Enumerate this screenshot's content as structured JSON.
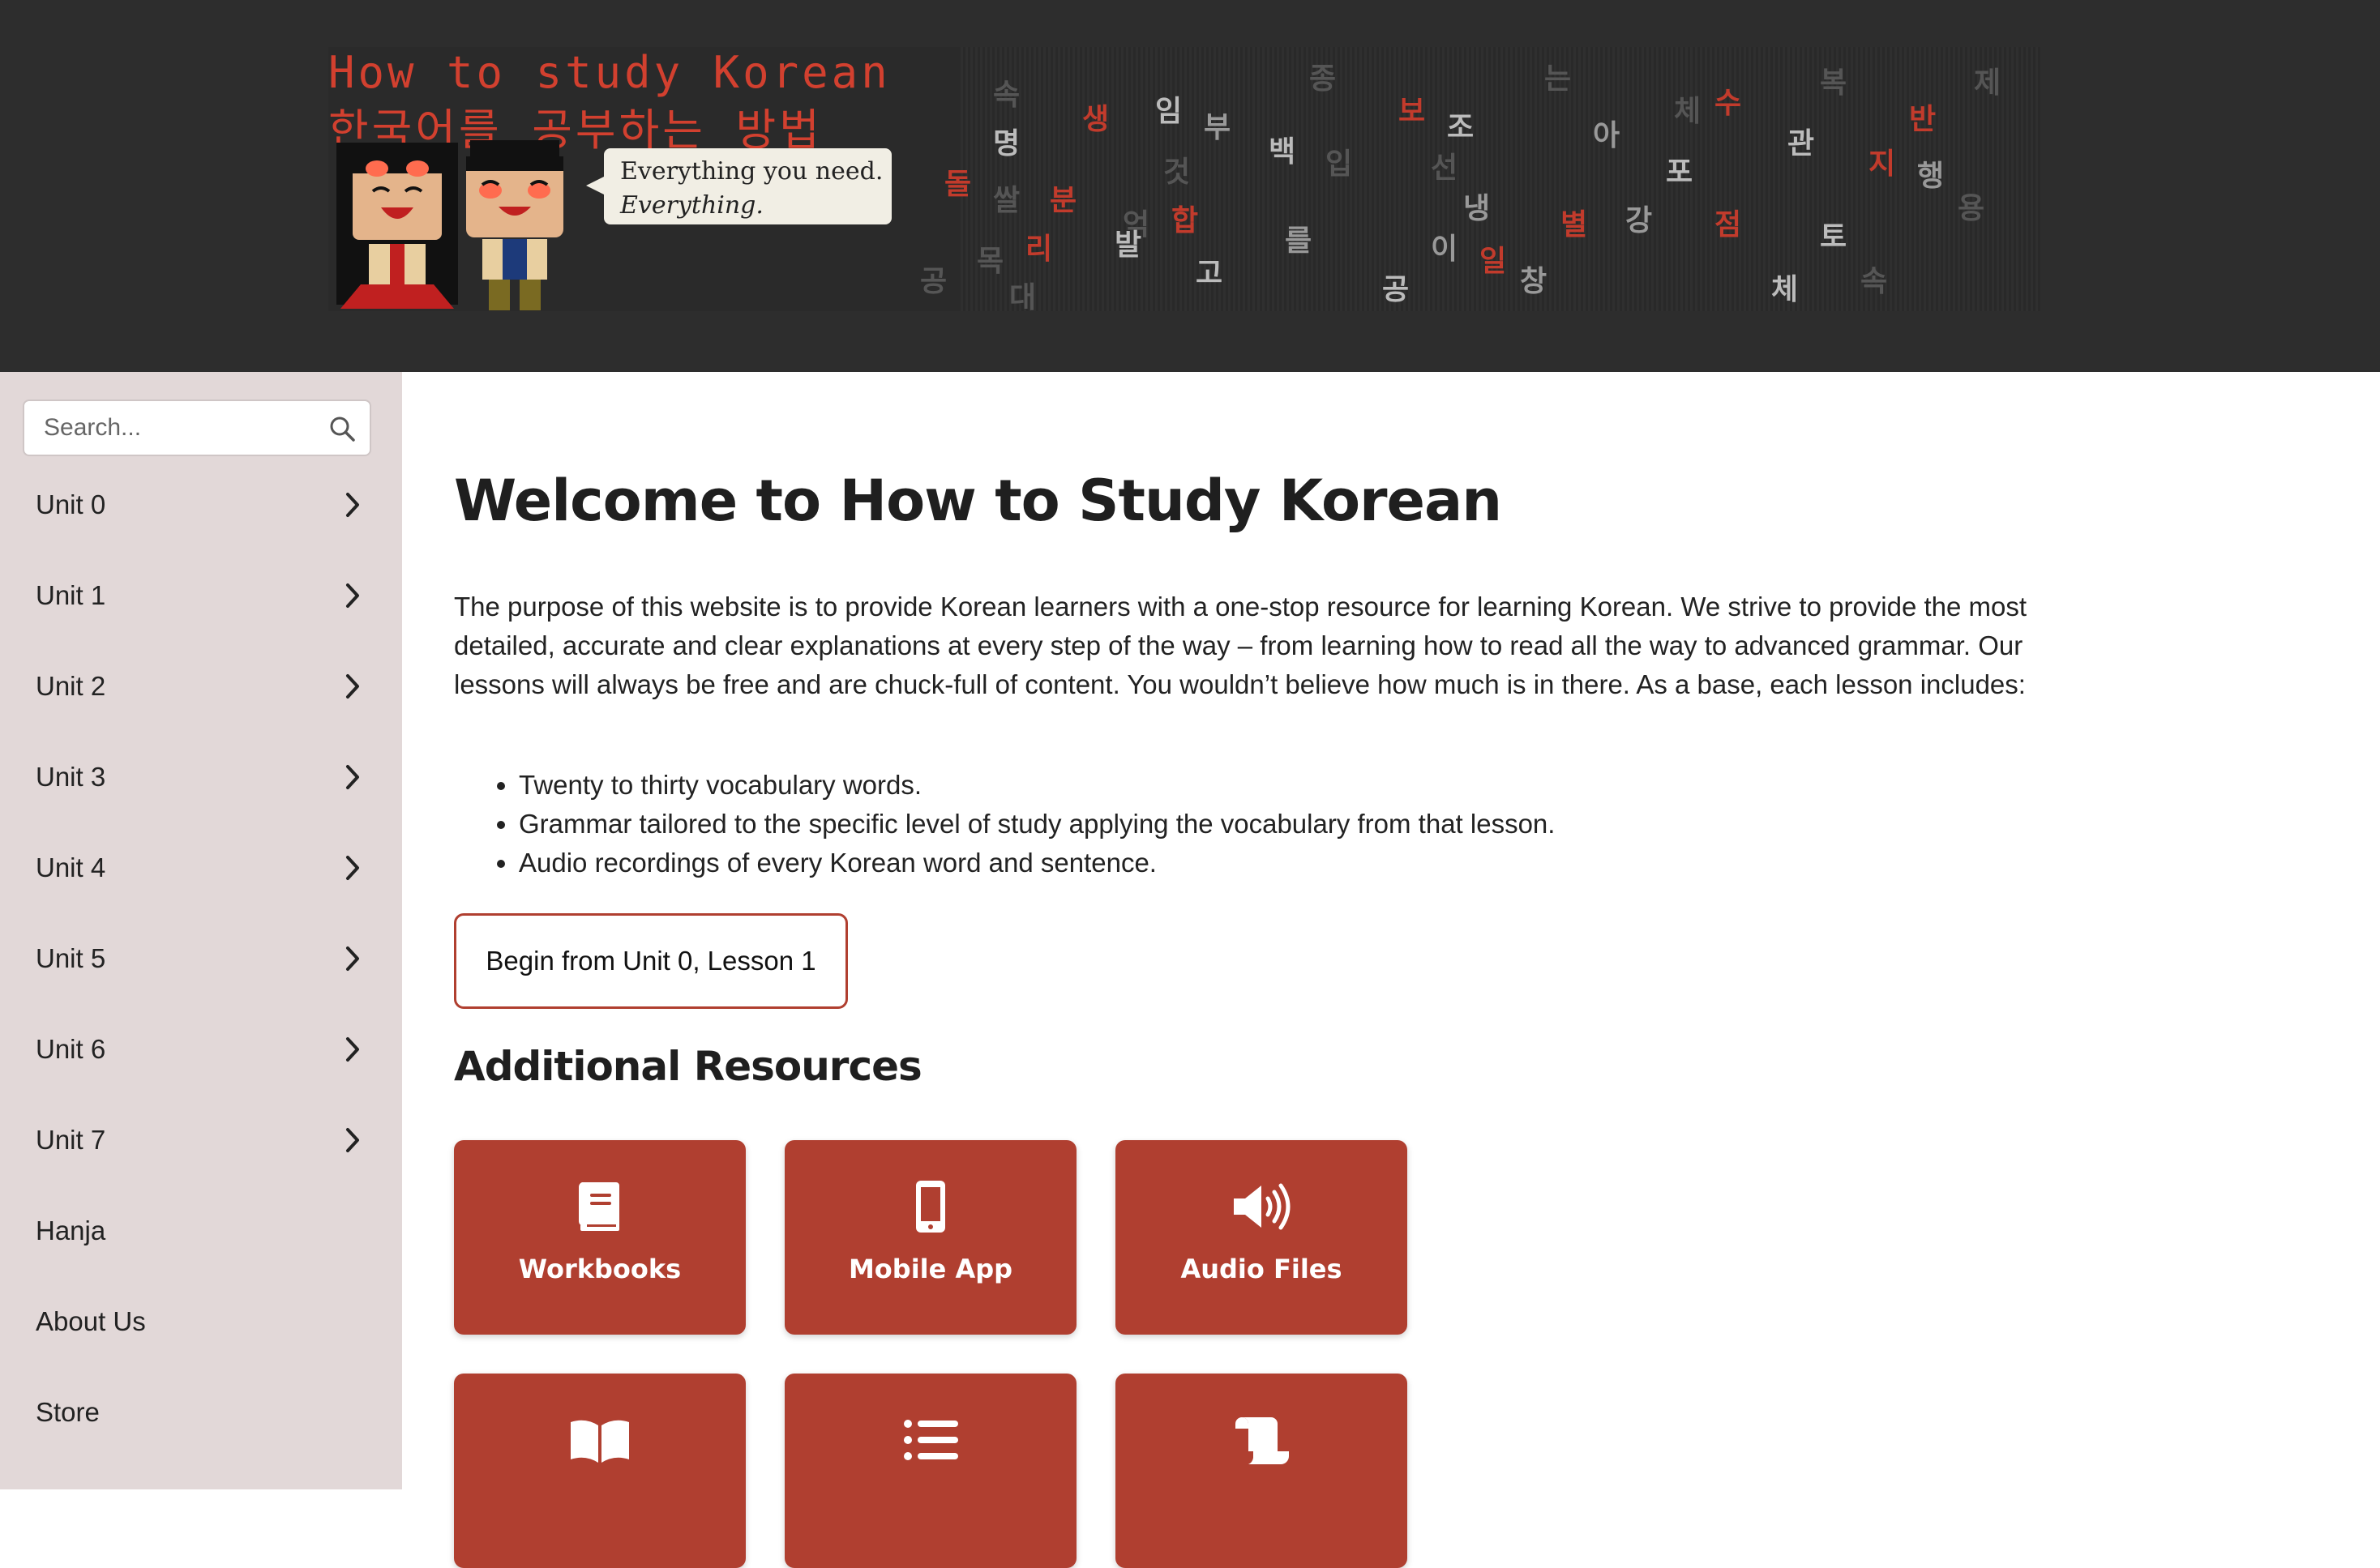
{
  "banner": {
    "title_en": "How to study Korean",
    "title_ko": "한국어를 공부하는 방법",
    "speech_line1": "Everything you need.",
    "speech_line2": "Everything."
  },
  "sidebar": {
    "search_placeholder": "Search...",
    "items": [
      {
        "label": "Unit 0",
        "has_arrow": true
      },
      {
        "label": "Unit 1",
        "has_arrow": true
      },
      {
        "label": "Unit 2",
        "has_arrow": true
      },
      {
        "label": "Unit 3",
        "has_arrow": true
      },
      {
        "label": "Unit 4",
        "has_arrow": true
      },
      {
        "label": "Unit 5",
        "has_arrow": true
      },
      {
        "label": "Unit 6",
        "has_arrow": true
      },
      {
        "label": "Unit 7",
        "has_arrow": true
      },
      {
        "label": "Hanja",
        "has_arrow": false
      },
      {
        "label": "About Us",
        "has_arrow": false
      },
      {
        "label": "Store",
        "has_arrow": false
      }
    ]
  },
  "main": {
    "title": "Welcome to How to Study Korean",
    "intro": "The purpose of this website is to provide Korean learners with a one-stop resource for learning Korean. We strive to provide the most detailed, accurate and clear explanations at every step of the way – from learning how to read all the way to advanced grammar. Our lessons will always be free and are chuck-full of content. You wouldn’t believe how much is in there. As a base, each lesson includes:",
    "bullets": [
      "Twenty to thirty vocabulary words.",
      "Grammar tailored to the specific level of study applying the vocabulary from that lesson.",
      "Audio recordings of every Korean word and sentence."
    ],
    "begin_button": "Begin from Unit 0, Lesson 1",
    "resources_heading": "Additional Resources",
    "resources": [
      {
        "label": "Workbooks",
        "icon": "book-icon"
      },
      {
        "label": "Mobile App",
        "icon": "mobile-phone-icon"
      },
      {
        "label": "Audio Files",
        "icon": "speaker-icon"
      },
      {
        "label": "",
        "icon": "open-book-icon"
      },
      {
        "label": "",
        "icon": "list-icon"
      },
      {
        "label": "",
        "icon": "scroll-icon"
      }
    ]
  },
  "colors": {
    "accent": "#b03f30",
    "header_bg": "#2d2d2d",
    "sidebar_bg": "#e2d8d8",
    "banner_red": "#d2402f"
  }
}
